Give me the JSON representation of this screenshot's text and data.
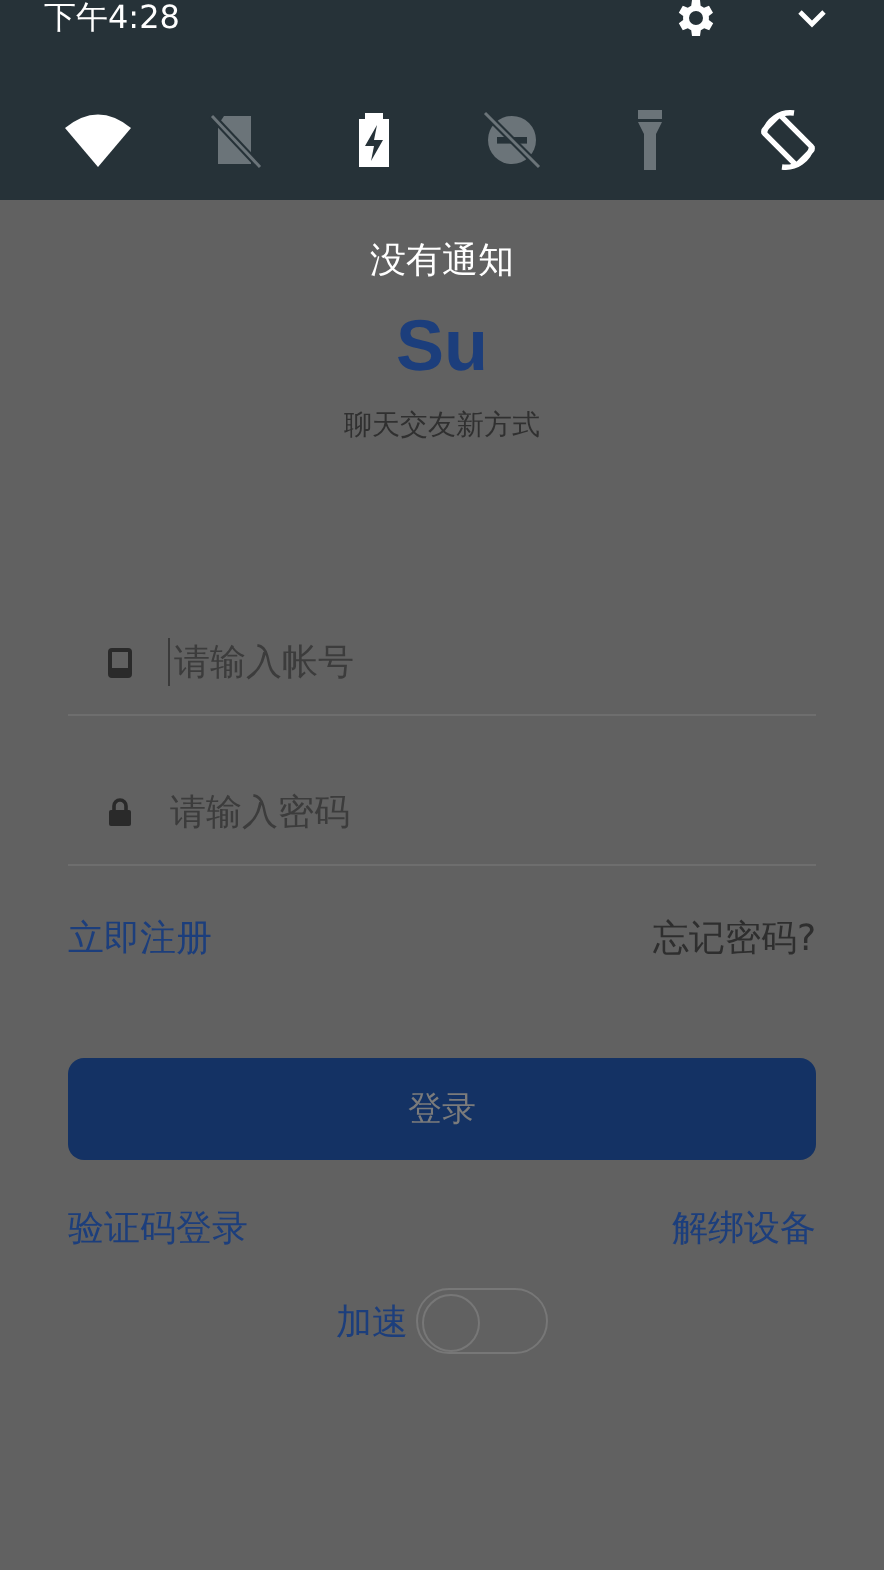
{
  "status_bar": {
    "time": "下午4:28"
  },
  "quick_settings": {
    "tiles": [
      {
        "kind": "wifi",
        "on": true
      },
      {
        "kind": "sim",
        "on": false
      },
      {
        "kind": "battery",
        "on": true
      },
      {
        "kind": "dnd",
        "on": false
      },
      {
        "kind": "flashlight",
        "on": false
      },
      {
        "kind": "rotate",
        "on": true
      }
    ]
  },
  "notifications": {
    "empty_text": "没有通知"
  },
  "app": {
    "logo": "Su",
    "slogan": "聊天交友新方式",
    "account_field": {
      "placeholder": "请输入帐号",
      "focused": true
    },
    "password_field": {
      "placeholder": "请输入密码",
      "focused": false
    },
    "register_link": "立即注册",
    "forgot_link": "忘记密码?",
    "login_button": "登录",
    "code_login_link": "验证码登录",
    "unbind_link": "解绑设备",
    "speed_toggle": {
      "label": "加速",
      "on": false
    }
  }
}
